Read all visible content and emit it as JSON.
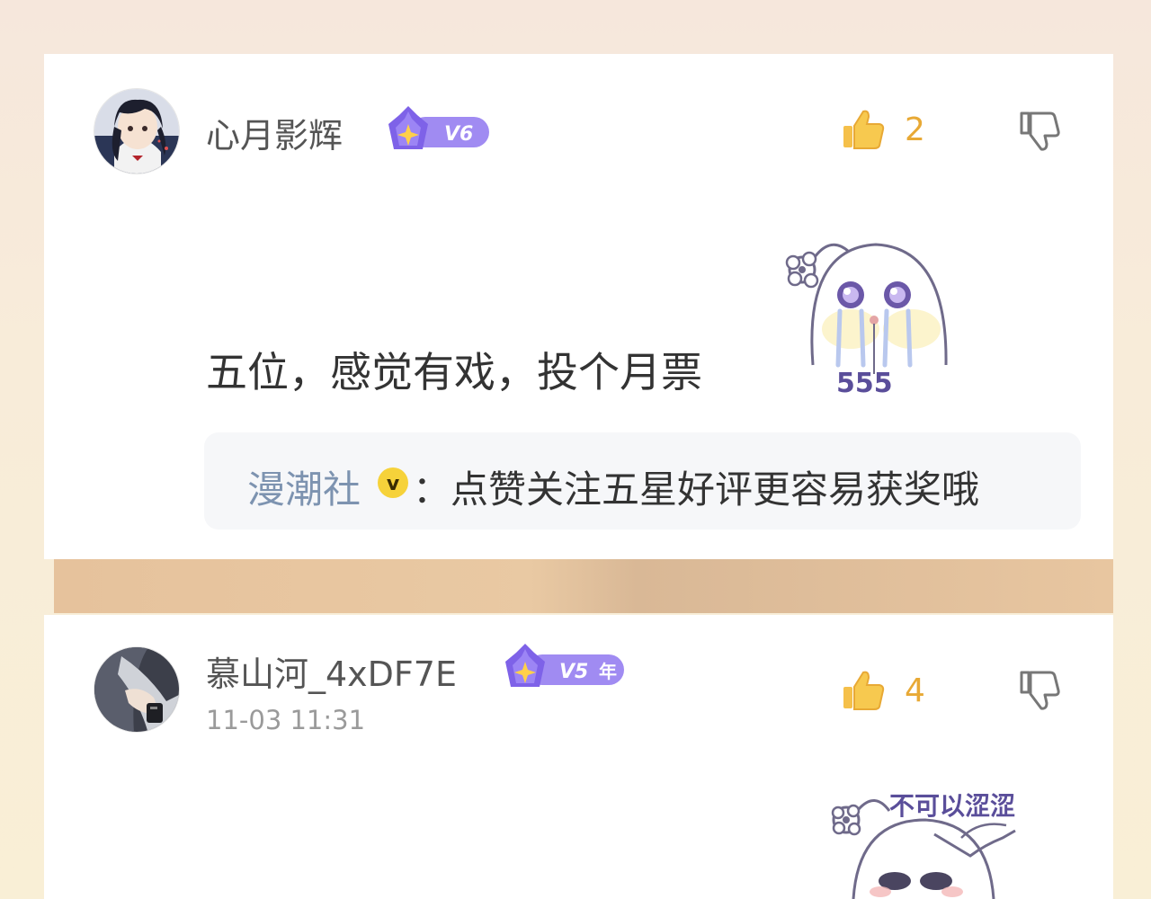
{
  "comments": [
    {
      "username": "心月影辉",
      "vip_level": "V6",
      "vip_badge_icon": "crown-star-icon",
      "likes": "2",
      "text": "五位，感觉有戏，投个月票",
      "sticker_text": "555",
      "reply": {
        "author": "漫潮社",
        "official_mark": "v",
        "separator": "：",
        "text": "点赞关注五星好评更容易获奖哦"
      }
    },
    {
      "username": "慕山河_4xDF7E",
      "vip_level": "V5",
      "vip_badge_suffix": "年",
      "vip_badge_icon": "crown-star-icon",
      "timestamp": "11-03 11:31",
      "likes": "4",
      "sticker_text": "不可以涩涩"
    }
  ],
  "colors": {
    "like_accent": "#e8a935",
    "vip_purple": "#8a6ef0",
    "reply_author": "#7d93b0",
    "username": "#555555"
  }
}
